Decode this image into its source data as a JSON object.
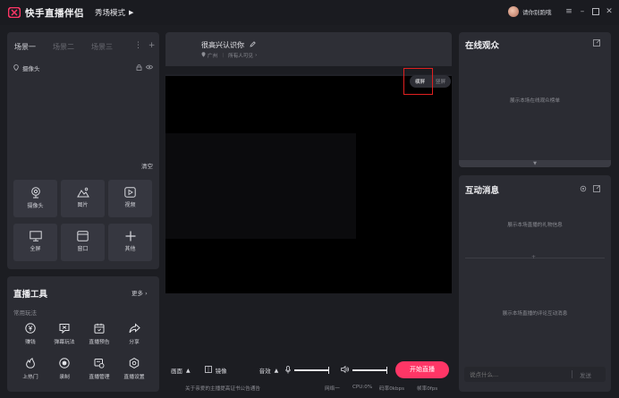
{
  "titlebar": {
    "app_title": "快手直播伴侣",
    "mode_label": "秀场模式",
    "username": "请你别跑哦"
  },
  "scenes": {
    "tabs": [
      "场景一",
      "场景二",
      "场景三"
    ],
    "source_name": "摄像头",
    "clear_label": "清空",
    "tiles": [
      {
        "label": "摄像头",
        "icon": "camera-icon"
      },
      {
        "label": "图片",
        "icon": "image-icon"
      },
      {
        "label": "视频",
        "icon": "video-icon"
      },
      {
        "label": "全屏",
        "icon": "fullscreen-icon"
      },
      {
        "label": "窗口",
        "icon": "window-icon"
      },
      {
        "label": "其他",
        "icon": "plus-icon"
      }
    ]
  },
  "live_tools": {
    "title": "直播工具",
    "more_label": "更多",
    "subtitle": "常用玩法",
    "tools": [
      {
        "label": "赚钱",
        "icon": "money-icon"
      },
      {
        "label": "弹幕玩法",
        "icon": "danmaku-icon"
      },
      {
        "label": "直播预告",
        "icon": "calendar-icon"
      },
      {
        "label": "分享",
        "icon": "share-icon"
      },
      {
        "label": "上热门",
        "icon": "fire-icon"
      },
      {
        "label": "录制",
        "icon": "record-icon"
      },
      {
        "label": "直播管理",
        "icon": "manage-icon"
      },
      {
        "label": "直播设置",
        "icon": "settings-icon"
      }
    ]
  },
  "stream": {
    "title": "很高兴认识你",
    "location": "广州",
    "visibility": "所有人可见",
    "orientation": {
      "landscape": "横屏",
      "portrait": "竖屏"
    }
  },
  "bottom_toolbar": {
    "scene_label": "画面",
    "mirror_label": "镜像",
    "sound_label": "音效",
    "start_label": "开始直播"
  },
  "status": {
    "notice": "关于亲爱的主播提高证书公告通告",
    "network": "网络一",
    "cpu": "CPU:0%",
    "bitrate": "码率0kbps",
    "fps": "帧率0fps"
  },
  "audience": {
    "title": "在线观众",
    "hint": "展示本场在线观众榜单"
  },
  "messages": {
    "title": "互动消息",
    "gift_hint": "展示本场直播的礼物信息",
    "comment_hint": "展示本场直播的评论互动消息",
    "input_placeholder": "说点什么...",
    "send_label": "发送"
  },
  "colors": {
    "accent": "#fe3666",
    "highlight_box": "#e02020"
  }
}
